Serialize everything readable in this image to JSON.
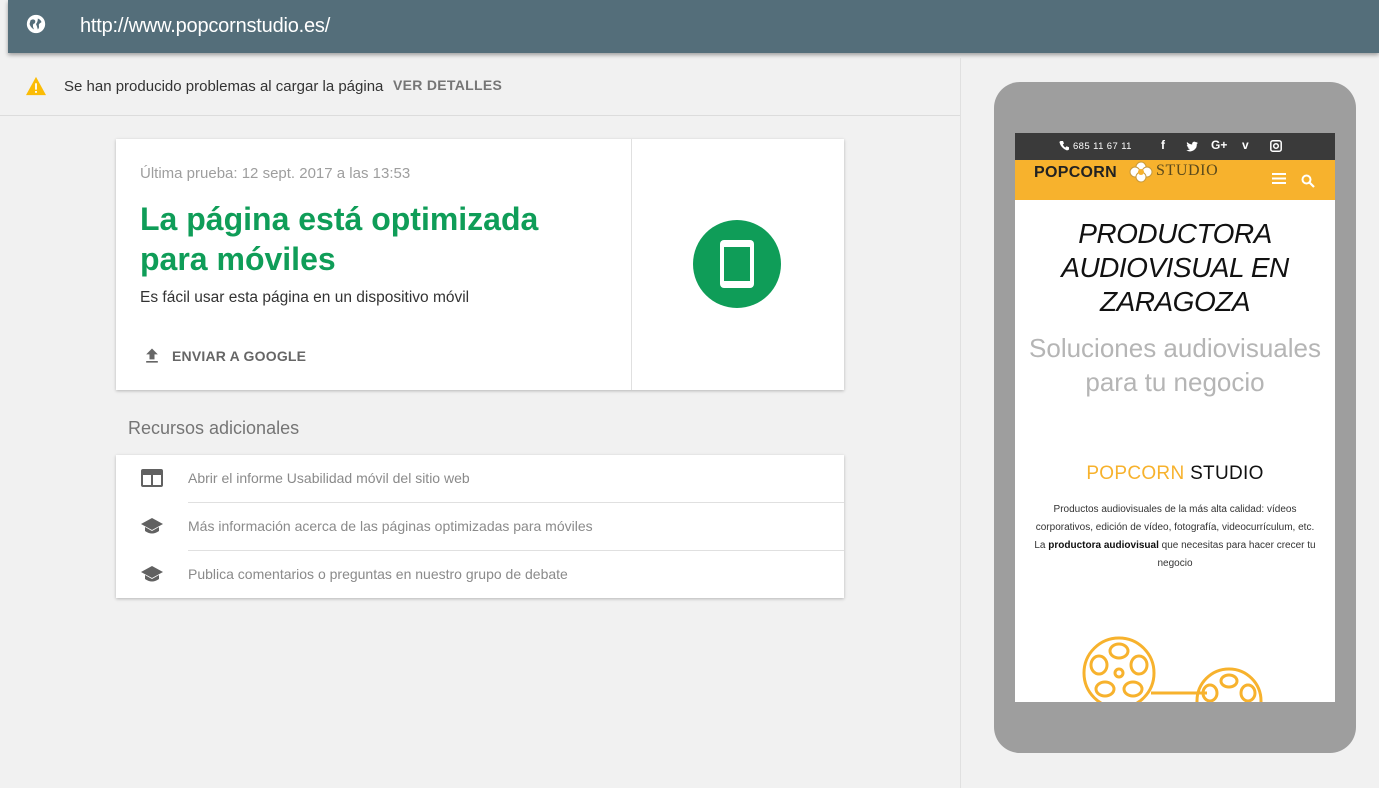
{
  "browser": {
    "url": "http://www.popcornstudio.es/"
  },
  "warning": {
    "text": "Se han producido problemas al cargar la página",
    "link": "VER DETALLES",
    "color": "#fbbc05"
  },
  "result": {
    "last_test": "Última prueba: 12 sept. 2017 a las 13:53",
    "headline": "La página está optimizada para móviles",
    "subline": "Es fácil usar esta página en un dispositivo móvil",
    "send_label": "ENVIAR A GOOGLE",
    "status_color": "#0f9d58",
    "status_icon": "mobile-phone-icon"
  },
  "resources": {
    "title": "Recursos adicionales",
    "items": [
      {
        "label": "Abrir el informe Usabilidad móvil del sitio web",
        "icon": "web-report-icon"
      },
      {
        "label": "Más información acerca de las páginas optimizadas para móviles",
        "icon": "school-icon"
      },
      {
        "label": "Publica comentarios o preguntas en nuestro grupo de debate",
        "icon": "school-icon"
      }
    ]
  },
  "preview": {
    "phone_number": "685 11 67 11",
    "social": [
      "f",
      "t",
      "G+",
      "v",
      "ig"
    ],
    "logo_bold": "POPCORN",
    "logo_light": "STUDIO",
    "heading": "PRODUCTORA AUDIOVISUAL EN ZARAGOZA",
    "subheading": "Soluciones audiovisuales para tu negocio",
    "brand_yellow": "POPCORN",
    "brand_black": "STUDIO",
    "desc_line1": "Productos audiovisuales de la más alta calidad: vídeos corporativos, edición de vídeo, fotografía, videocurrículum, etc.",
    "desc_pre": "La",
    "desc_bold": "productora audiovisual",
    "desc_post": "que necesitas para hacer crecer tu negocio",
    "accent_color": "#f7b22d"
  }
}
